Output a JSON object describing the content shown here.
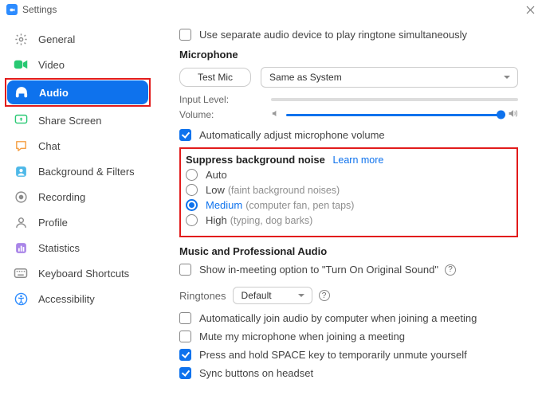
{
  "title": "Settings",
  "sidebar": {
    "items": [
      {
        "label": "General"
      },
      {
        "label": "Video"
      },
      {
        "label": "Audio"
      },
      {
        "label": "Share Screen"
      },
      {
        "label": "Chat"
      },
      {
        "label": "Background & Filters"
      },
      {
        "label": "Recording"
      },
      {
        "label": "Profile"
      },
      {
        "label": "Statistics"
      },
      {
        "label": "Keyboard Shortcuts"
      },
      {
        "label": "Accessibility"
      }
    ]
  },
  "audio": {
    "separate_device": "Use separate audio device to play ringtone simultaneously",
    "mic_heading": "Microphone",
    "test_mic": "Test Mic",
    "mic_device": "Same as System",
    "input_level_label": "Input Level:",
    "volume_label": "Volume:",
    "auto_adjust": "Automatically adjust microphone volume",
    "noise": {
      "heading": "Suppress background noise",
      "learn_more": "Learn more",
      "auto": "Auto",
      "low": "Low",
      "low_hint": "(faint background noises)",
      "medium": "Medium",
      "medium_hint": "(computer fan, pen taps)",
      "high": "High",
      "high_hint": "(typing, dog barks)"
    },
    "pro_heading": "Music and Professional Audio",
    "original_sound": "Show in-meeting option to \"Turn On Original Sound\"",
    "ringtones_label": "Ringtones",
    "ringtone_value": "Default",
    "auto_join": "Automatically join audio by computer when joining a meeting",
    "mute_join": "Mute my microphone when joining a meeting",
    "space_unmute": "Press and hold SPACE key to temporarily unmute yourself",
    "sync_headset": "Sync buttons on headset"
  }
}
